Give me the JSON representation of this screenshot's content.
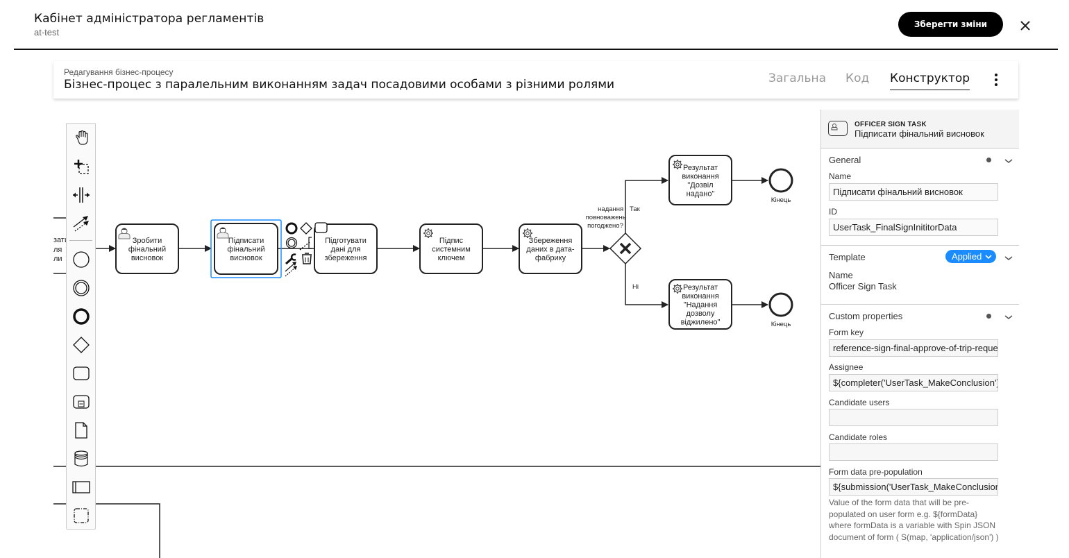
{
  "header": {
    "title": "Кабінет адміністратора регламентів",
    "subtitle": "at-test",
    "save_label": "Зберегти зміни",
    "close_icon": "close-icon"
  },
  "process": {
    "breadcrumb": "Редагування бізнес-процесу",
    "title": "Бізнес-процес з паралельним виконанням задач посадовими особами з різними ролями",
    "tabs": [
      {
        "label": "Загальна",
        "active": false
      },
      {
        "label": "Код",
        "active": false
      },
      {
        "label": "Конструктор",
        "active": true
      }
    ],
    "more_icon": "more-vertical-icon"
  },
  "palette": {
    "tools": [
      {
        "name": "hand-tool-icon"
      },
      {
        "name": "lasso-tool-icon"
      },
      {
        "name": "space-tool-icon"
      },
      {
        "name": "global-connect-tool-icon"
      },
      {
        "name": "create-start-event-icon"
      },
      {
        "name": "create-intermediate-event-icon"
      },
      {
        "name": "create-end-event-icon"
      },
      {
        "name": "create-gateway-icon"
      },
      {
        "name": "create-task-icon"
      },
      {
        "name": "create-subprocess-icon"
      },
      {
        "name": "create-data-object-icon"
      },
      {
        "name": "create-data-store-icon"
      },
      {
        "name": "create-pool-icon"
      },
      {
        "name": "create-group-icon"
      }
    ]
  },
  "diagram": {
    "partial_left_text": [
      "зати",
      "ля",
      "ли"
    ],
    "tasks": [
      {
        "id": "make-conclusion",
        "type": "user",
        "lines": [
          "Зробити",
          "фінальний",
          "висновок"
        ]
      },
      {
        "id": "sign-conclusion",
        "type": "user",
        "selected": true,
        "lines": [
          "Підписати",
          "фінальний",
          "висновок"
        ]
      },
      {
        "id": "prepare-data",
        "type": "plain",
        "lines": [
          "Підготувати",
          "дані для",
          "збереження"
        ]
      },
      {
        "id": "system-sign",
        "type": "service",
        "lines": [
          "Підпис",
          "системним",
          "ключем"
        ]
      },
      {
        "id": "save-data",
        "type": "service",
        "lines": [
          "Збереження",
          "даних в дата-",
          "фабрику"
        ]
      },
      {
        "id": "result-granted",
        "type": "service",
        "lines": [
          "Результат",
          "виконання",
          "\"Дозвіл",
          "надано\""
        ]
      },
      {
        "id": "result-denied",
        "type": "service",
        "lines": [
          "Результат",
          "виконання",
          "\"Надання",
          "дозволу",
          "віджилено\""
        ]
      }
    ],
    "gateway_label": [
      "надання",
      "повноважень",
      "погоджено?"
    ],
    "flow_yes": "Так",
    "flow_no": "Ні",
    "end_label_1": "Кінець",
    "end_label_2": "Кінець"
  },
  "properties": {
    "element_type": "OFFICER SIGN TASK",
    "element_name": "Підписати фінальний висновок",
    "general": {
      "title": "General",
      "name_label": "Name",
      "name_value": "Підписати фінальний висновок",
      "id_label": "ID",
      "id_value": "UserTask_FinalSignInititorData"
    },
    "template": {
      "title": "Template",
      "badge": "Applied",
      "name_label": "Name",
      "name_value": "Officer Sign Task"
    },
    "custom": {
      "title": "Custom properties",
      "form_key_label": "Form key",
      "form_key_value": "reference-sign-final-approve-of-trip-request",
      "assignee_label": "Assignee",
      "assignee_value": "${completer('UserTask_MakeConclusion').userId}",
      "candidate_users_label": "Candidate users",
      "candidate_users_value": "",
      "candidate_roles_label": "Candidate roles",
      "candidate_roles_value": "",
      "prepop_label": "Form data pre-population",
      "prepop_value": "${submission('UserTask_MakeConclusion').formData}",
      "prepop_desc": "Value of the form data that will be pre-populated on user form e.g. ${formData} where formData is a variable with Spin JSON document of form ( S(map, 'application/json') )"
    }
  },
  "colors": {
    "selection": "#1a8cff",
    "applied_badge": "#1a8cff",
    "primary_button": "#000000"
  }
}
